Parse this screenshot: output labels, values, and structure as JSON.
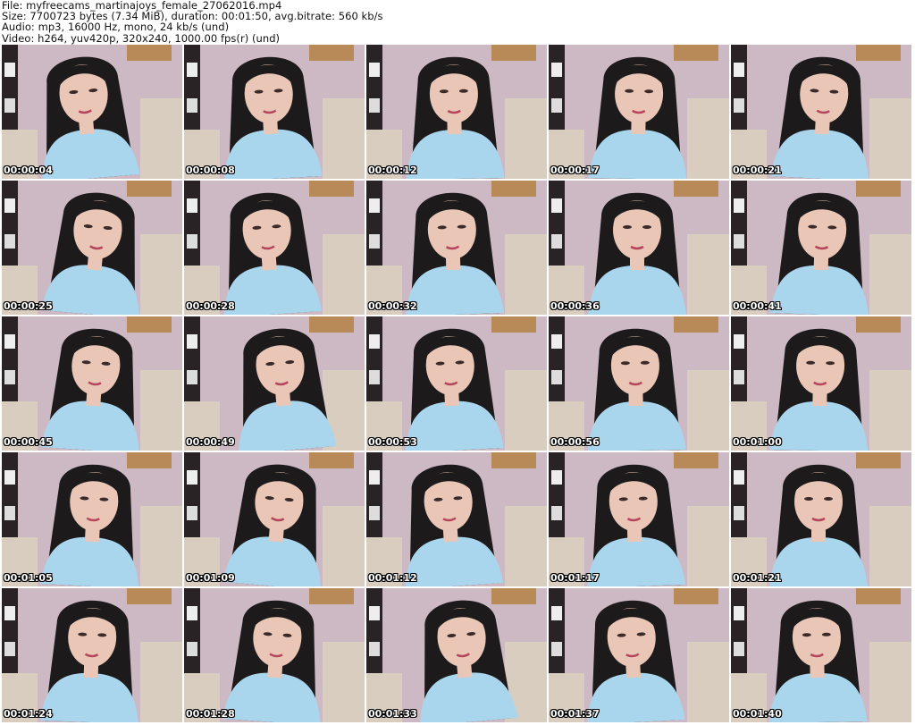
{
  "header": {
    "file_line": "File: myfreecams_martinajoys_female_27062016.mp4",
    "size_line": "Size: 7700723 bytes (7.34 MiB), duration: 00:01:50, avg.bitrate: 560 kb/s",
    "audio_line": "Audio: mp3, 16000 Hz, mono, 24 kb/s (und)",
    "video_line": "Video: h264, yuv420p, 320x240, 1000.00 fps(r) (und)"
  },
  "thumbnails": [
    {
      "timestamp": "00:00:04"
    },
    {
      "timestamp": "00:00:08"
    },
    {
      "timestamp": "00:00:12"
    },
    {
      "timestamp": "00:00:17"
    },
    {
      "timestamp": "00:00:21"
    },
    {
      "timestamp": "00:00:25"
    },
    {
      "timestamp": "00:00:28"
    },
    {
      "timestamp": "00:00:32"
    },
    {
      "timestamp": "00:00:36"
    },
    {
      "timestamp": "00:00:41"
    },
    {
      "timestamp": "00:00:45"
    },
    {
      "timestamp": "00:00:49"
    },
    {
      "timestamp": "00:00:53"
    },
    {
      "timestamp": "00:00:56"
    },
    {
      "timestamp": "00:01:00"
    },
    {
      "timestamp": "00:01:05"
    },
    {
      "timestamp": "00:01:09"
    },
    {
      "timestamp": "00:01:12"
    },
    {
      "timestamp": "00:01:17"
    },
    {
      "timestamp": "00:01:21"
    },
    {
      "timestamp": "00:01:24"
    },
    {
      "timestamp": "00:01:28"
    },
    {
      "timestamp": "00:01:33"
    },
    {
      "timestamp": "00:01:37"
    },
    {
      "timestamp": "00:01:40"
    }
  ],
  "colors": {
    "wall": "#cdb9c3",
    "hair": "#1d1a1c",
    "skin": "#e9c6b6",
    "shirt": "#a9d6ec",
    "furniture": "#d8cdbe",
    "frame": "#2a2325",
    "poster": "#b88a57"
  }
}
